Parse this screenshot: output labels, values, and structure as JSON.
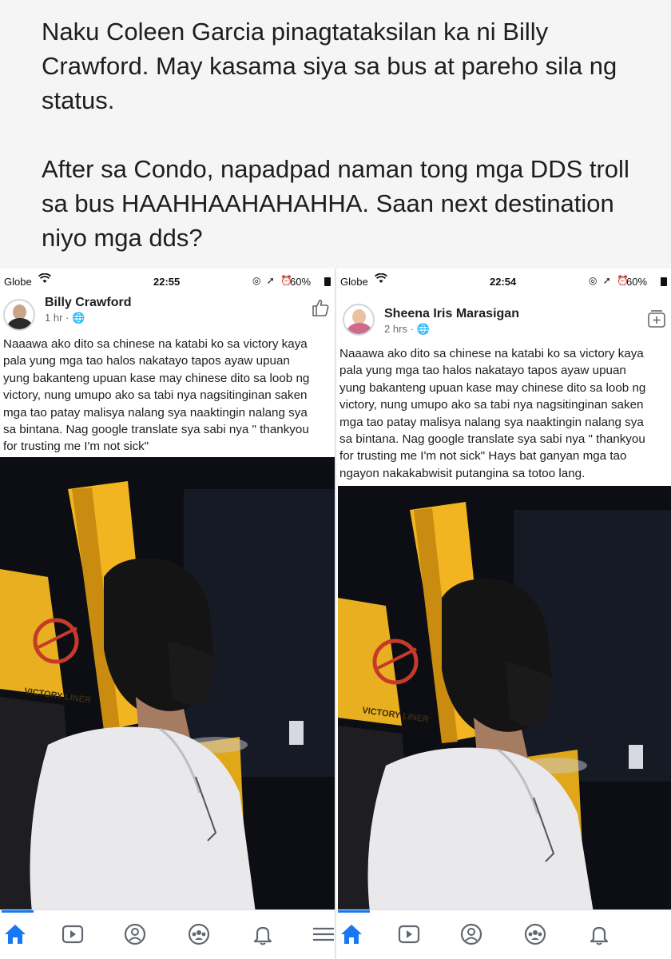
{
  "header": {
    "text": "Naku Coleen Garcia pinagtataksilan ka ni Billy Crawford. May kasama siya sa bus at pareho sila ng status.\n\nAfter sa Condo, napadpad naman tong mga DDS troll sa bus HAAHHAAHAHAHHA. Saan next destination niyo mga dds?"
  },
  "screenshots": [
    {
      "statusbar": {
        "carrier": "Globe",
        "time": "22:55",
        "battery": "60%",
        "icons": "◎ ➚ ⏰"
      },
      "author": "Billy Crawford",
      "meta": "1 hr · 🌐",
      "corner_icon": "thumbs-up-icon",
      "text": "Naaawa ako dito sa chinese na katabi ko sa victory kaya\npala yung mga tao halos nakatayo tapos ayaw upuan\nyung bakanteng upuan kase may chinese dito sa loob ng\nvictory, nung umupo ako sa tabi nya nagsitinginan saken\nmga tao patay malisya nalang sya naaktingin nalang sya\nsa bintana. Nag google translate sya sabi nya \" thankyou\nfor trusting me I'm not sick\"",
      "photo_text": "VICTORY LINER"
    },
    {
      "statusbar": {
        "carrier": "Globe",
        "time": "22:54",
        "battery": "60%",
        "icons": "◎ ➚ ⏰"
      },
      "author": "Sheena Iris Marasigan",
      "meta": "2 hrs · 🌐",
      "corner_icon": "add-to-list-icon",
      "text": "Naaawa ako dito sa chinese na katabi ko sa victory kaya\npala yung mga tao halos nakatayo tapos ayaw upuan\nyung bakanteng upuan kase may chinese dito sa loob ng\nvictory, nung umupo ako sa tabi nya nagsitinginan saken\nmga tao patay malisya nalang sya naaktingin nalang sya\nsa bintana. Nag google translate sya sabi nya \" thankyou\nfor trusting me I'm not sick\" Hays bat ganyan mga tao\nngayon nakakabwisit putangina sa totoo lang.",
      "photo_text": "VICTORY LINER"
    }
  ],
  "tabbar": {
    "tabs": [
      "home-icon",
      "video-icon",
      "profile-icon",
      "groups-icon",
      "notifications-icon",
      "menu-icon"
    ],
    "active": "home-icon"
  },
  "colors": {
    "accent": "#1877f2",
    "text": "#1c1e21",
    "meta": "#65676b",
    "bus_yellow": "#f0b320"
  }
}
